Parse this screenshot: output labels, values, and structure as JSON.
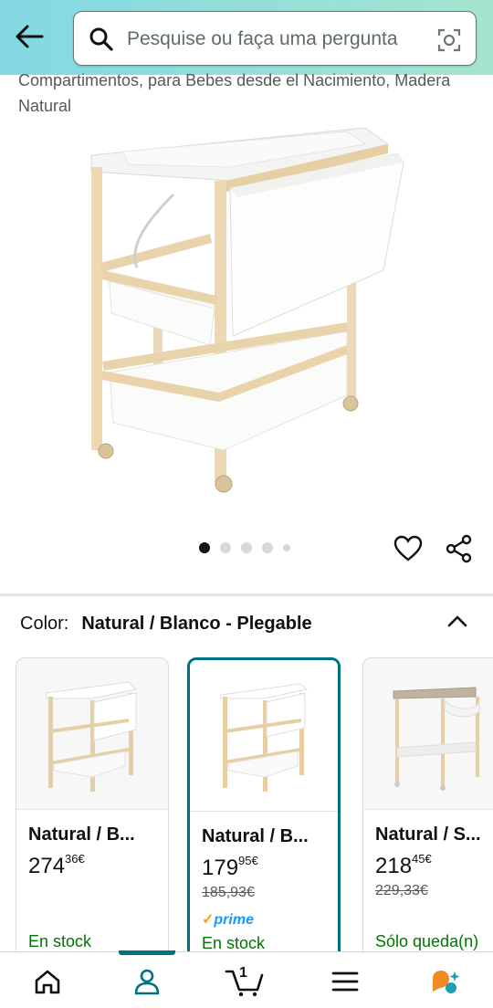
{
  "header": {
    "search_placeholder": "Pesquise ou faça uma pergunta"
  },
  "product": {
    "title_partial": "Compartimentos, para Bebes desde el Nacimiento, Madera Natural",
    "image_dots": 5,
    "active_dot": 0
  },
  "color": {
    "label": "Color:",
    "selected": "Natural / Blanco - Plegable"
  },
  "variants": [
    {
      "name": "Natural / B...",
      "price_whole": "274",
      "price_fraction": "36",
      "currency": "€",
      "old_price": "",
      "prime": false,
      "stock": "En stock",
      "selected": false
    },
    {
      "name": "Natural / B...",
      "price_whole": "179",
      "price_fraction": "95",
      "currency": "€",
      "old_price": "185,93€",
      "prime": true,
      "prime_label": "prime",
      "stock": "En stock",
      "selected": true
    },
    {
      "name": "Natural / S...",
      "price_whole": "218",
      "price_fraction": "45",
      "currency": "€",
      "old_price": "229,33€",
      "prime": false,
      "stock": "Sólo queda(n)",
      "selected": false
    }
  ],
  "bottom_nav": {
    "cart_count": "1",
    "items": [
      "home-icon",
      "account-icon",
      "cart-icon",
      "menu-icon",
      "rufus-icon"
    ]
  },
  "colors": {
    "accent": "#007185",
    "in_stock": "#007600",
    "prime": "#1399ff"
  }
}
